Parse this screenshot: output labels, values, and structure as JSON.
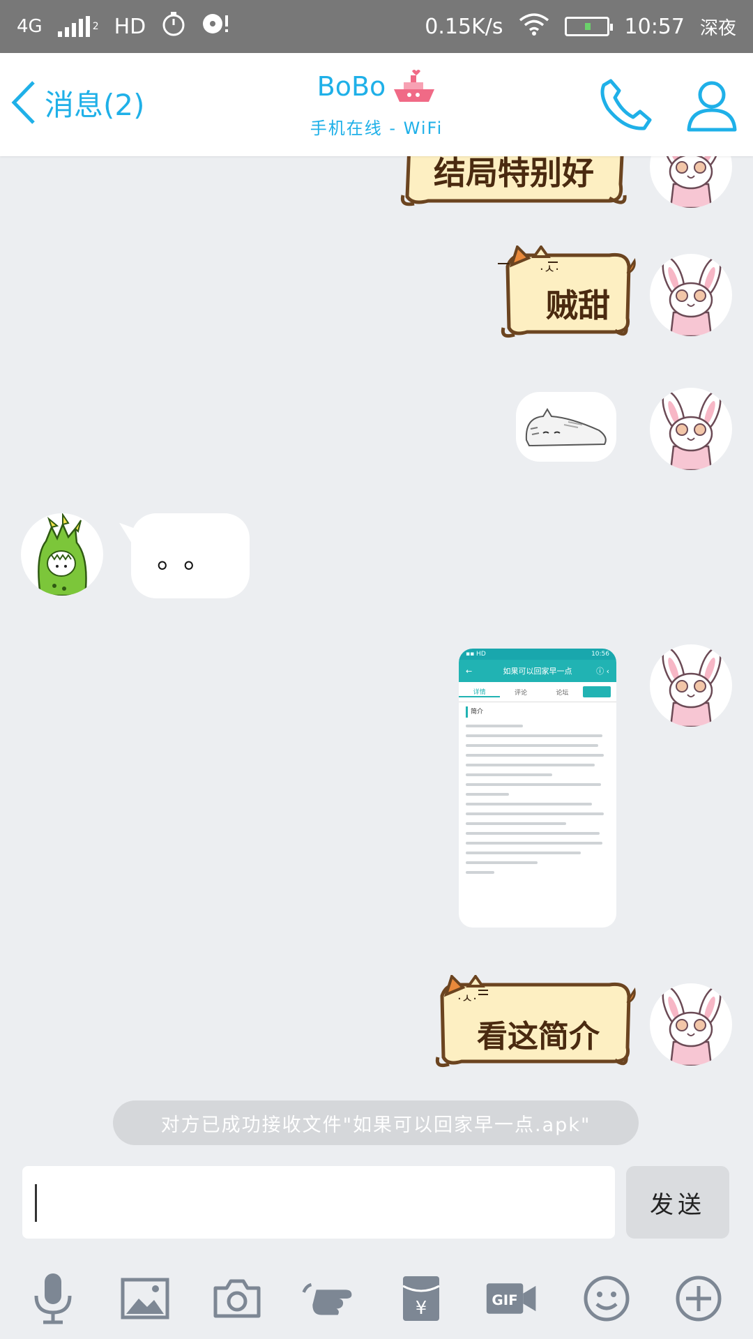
{
  "status_bar": {
    "network": "4G",
    "sim_badge": "2",
    "hd": "HD",
    "speed": "0.15K/s",
    "time": "10:57",
    "mode": "深夜"
  },
  "header": {
    "back_label": "消息(2)",
    "contact_name": "BoBo",
    "contact_status": "手机在线 - WiFi"
  },
  "messages": [
    {
      "side": "right",
      "type": "sticker",
      "text": "结局特别好"
    },
    {
      "side": "right",
      "type": "sticker",
      "text": "贼甜"
    },
    {
      "side": "right",
      "type": "image",
      "icon": "sleeping-cat-sticker"
    },
    {
      "side": "left",
      "type": "text",
      "text": "。。"
    },
    {
      "side": "right",
      "type": "image",
      "icon": "app-screenshot"
    },
    {
      "side": "right",
      "type": "sticker",
      "text": "看这简介"
    }
  ],
  "thumb": {
    "title": "如果可以回家早一点",
    "tabs": [
      "详情",
      "评论",
      "论坛"
    ],
    "section": "简介"
  },
  "notice": "对方已成功接收文件\"如果可以回家早一点.apk\"",
  "input": {
    "value": ""
  },
  "send_label": "发送",
  "toolbar": [
    "microphone-icon",
    "image-icon",
    "camera-icon",
    "poke-icon",
    "red-packet-icon",
    "gif-icon",
    "emoji-icon",
    "plus-icon"
  ],
  "colors": {
    "accent": "#1fb0e8",
    "status_bar": "#787878",
    "background": "#eceef1",
    "sticker_fill": "#fdefc2",
    "sticker_outline": "#6b4420"
  }
}
